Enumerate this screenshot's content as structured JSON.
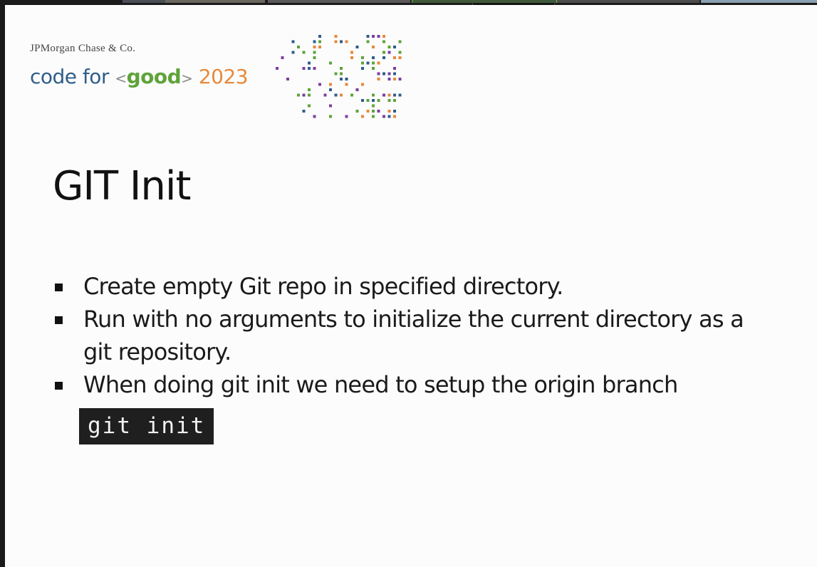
{
  "window_controls": {
    "drag_handle_icon": "grip-dots-icon",
    "toggle_icon": "chevron-down-icon"
  },
  "slide": {
    "company": "JPMorgan Chase & Co.",
    "brand": {
      "code": "code for",
      "open_bracket": "<",
      "good": "good",
      "close_bracket": ">",
      "year": "2023"
    },
    "brand_colors": {
      "blue": "#2f5d8a",
      "green": "#5ea33a",
      "orange": "#e8893a",
      "purple": "#7b3f9e"
    },
    "title": "GIT Init",
    "bullets": [
      "Create empty Git repo in specified directory.",
      "Run with no arguments to initialize the current directory as a git repository.",
      "When doing git init we need to setup the origin branch"
    ],
    "code": "git init"
  }
}
